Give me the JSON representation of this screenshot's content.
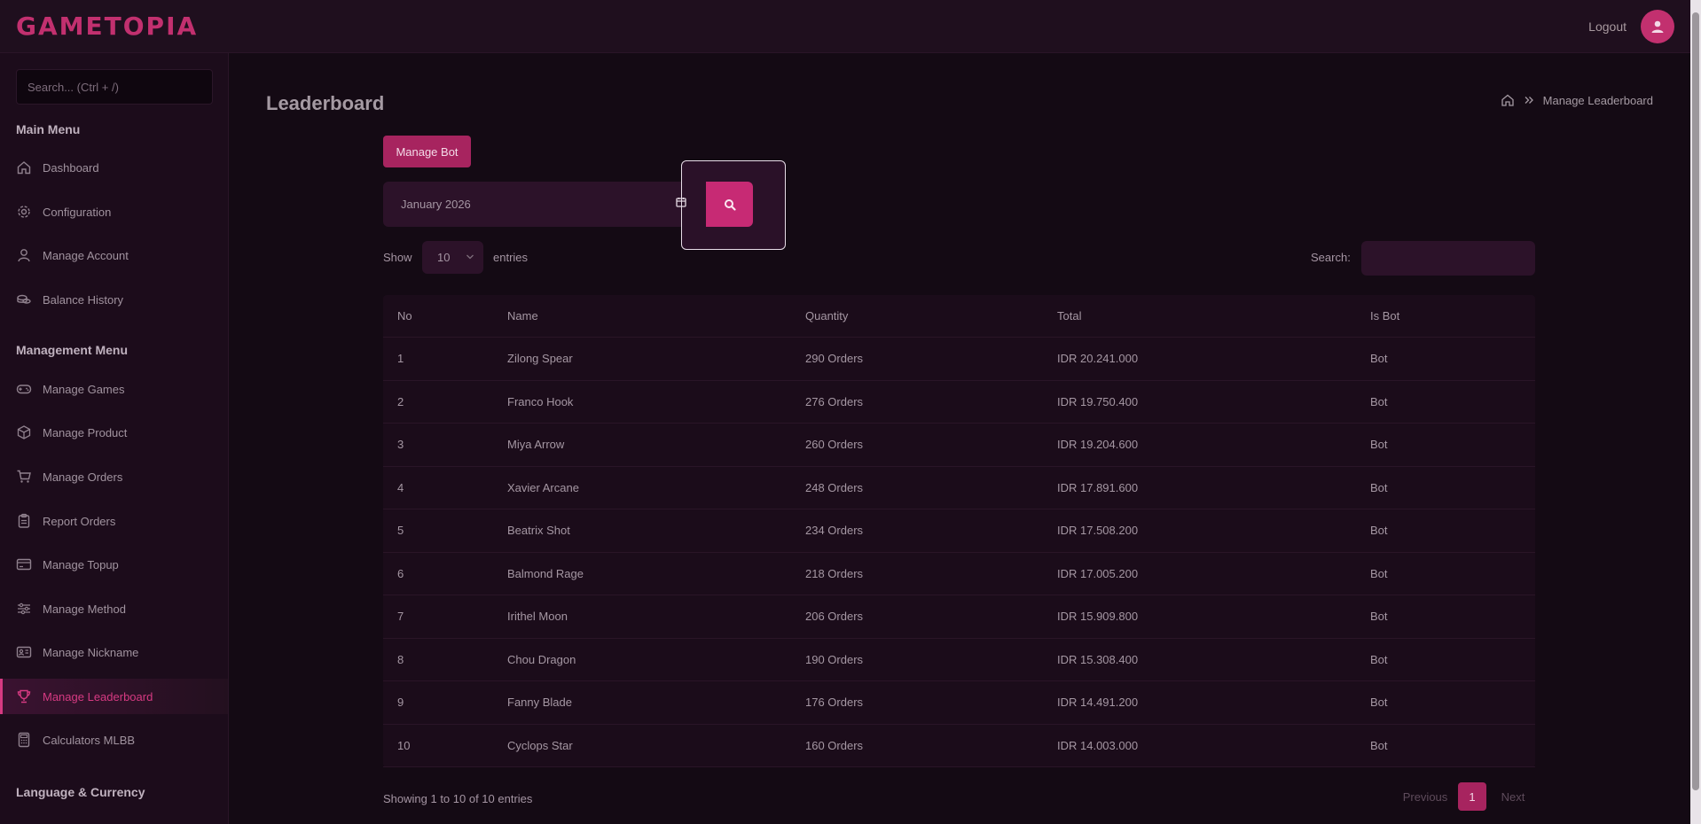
{
  "header": {
    "logo": "GAMETOPIA",
    "logout_label": "Logout"
  },
  "sidebar": {
    "search_placeholder": "Search... (Ctrl + /)",
    "main_menu_title": "Main Menu",
    "main_items": [
      {
        "label": "Dashboard",
        "icon": "home-icon"
      },
      {
        "label": "Configuration",
        "icon": "gear-icon"
      },
      {
        "label": "Manage Account",
        "icon": "user-icon"
      },
      {
        "label": "Balance History",
        "icon": "coins-icon"
      }
    ],
    "management_menu_title": "Management Menu",
    "management_items": [
      {
        "label": "Manage Games",
        "icon": "gamepad-icon"
      },
      {
        "label": "Manage Product",
        "icon": "box-icon"
      },
      {
        "label": "Manage Orders",
        "icon": "cart-icon"
      },
      {
        "label": "Report Orders",
        "icon": "clipboard-icon"
      },
      {
        "label": "Manage Topup",
        "icon": "card-icon"
      },
      {
        "label": "Manage Method",
        "icon": "sliders-icon"
      },
      {
        "label": "Manage Nickname",
        "icon": "id-card-icon"
      },
      {
        "label": "Manage Leaderboard",
        "icon": "trophy-icon",
        "active": true
      },
      {
        "label": "Calculators MLBB",
        "icon": "calculator-icon"
      }
    ],
    "language_title": "Language & Currency"
  },
  "main": {
    "title": "Leaderboard",
    "breadcrumb": {
      "current": "Manage Leaderboard"
    },
    "manage_bot_label": "Manage Bot",
    "month_value": "January 2026",
    "show_label": "Show",
    "entries_value": "10",
    "entries_label": "entries",
    "search_label": "Search:",
    "table": {
      "headers": [
        "No",
        "Name",
        "Quantity",
        "Total",
        "Is Bot"
      ],
      "rows": [
        [
          "1",
          "Zilong Spear",
          "290 Orders",
          "IDR 20.241.000",
          "Bot"
        ],
        [
          "2",
          "Franco Hook",
          "276 Orders",
          "IDR 19.750.400",
          "Bot"
        ],
        [
          "3",
          "Miya Arrow",
          "260 Orders",
          "IDR 19.204.600",
          "Bot"
        ],
        [
          "4",
          "Xavier Arcane",
          "248 Orders",
          "IDR 17.891.600",
          "Bot"
        ],
        [
          "5",
          "Beatrix Shot",
          "234 Orders",
          "IDR 17.508.200",
          "Bot"
        ],
        [
          "6",
          "Balmond Rage",
          "218 Orders",
          "IDR 17.005.200",
          "Bot"
        ],
        [
          "7",
          "Irithel Moon",
          "206 Orders",
          "IDR 15.909.800",
          "Bot"
        ],
        [
          "8",
          "Chou Dragon",
          "190 Orders",
          "IDR 15.308.400",
          "Bot"
        ],
        [
          "9",
          "Fanny Blade",
          "176 Orders",
          "IDR 14.491.200",
          "Bot"
        ],
        [
          "10",
          "Cyclops Star",
          "160 Orders",
          "IDR 14.003.000",
          "Bot"
        ]
      ]
    },
    "showing_text": "Showing 1 to 10 of 10 entries",
    "pagination": {
      "previous": "Previous",
      "current": "1",
      "next": "Next"
    }
  }
}
